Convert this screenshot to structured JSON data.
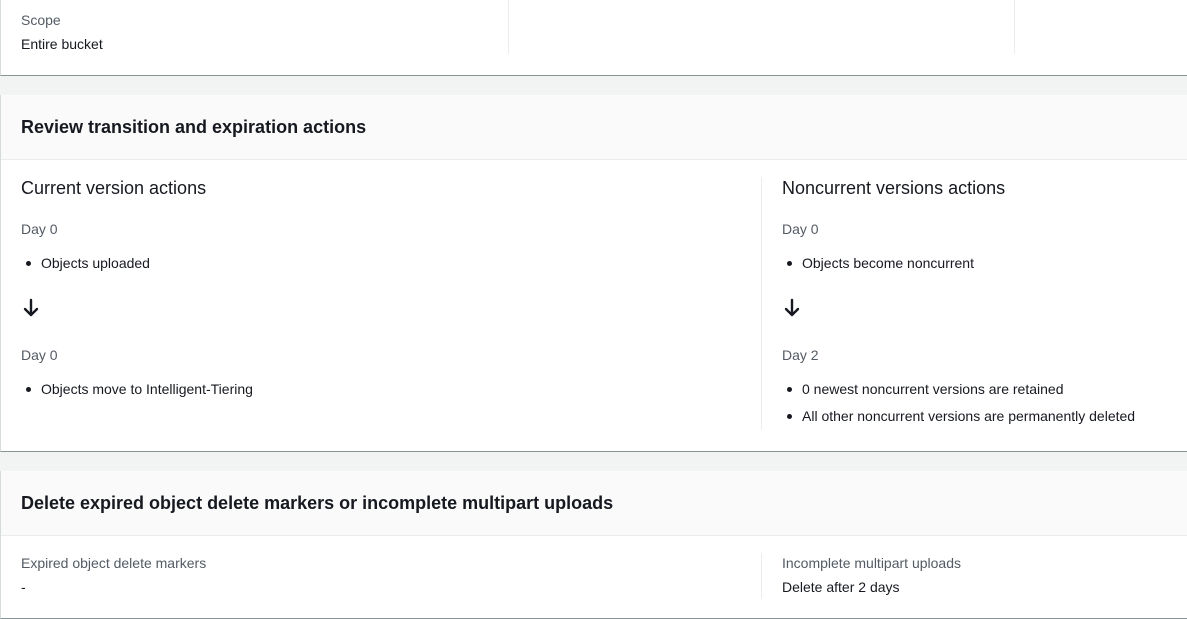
{
  "scope": {
    "label": "Scope",
    "value": "Entire bucket"
  },
  "review": {
    "title": "Review transition and expiration actions",
    "current": {
      "title": "Current version actions",
      "steps": [
        {
          "day": "Day 0",
          "items": [
            "Objects uploaded"
          ]
        },
        {
          "day": "Day 0",
          "items": [
            "Objects move to Intelligent-Tiering"
          ]
        }
      ]
    },
    "noncurrent": {
      "title": "Noncurrent versions actions",
      "steps": [
        {
          "day": "Day 0",
          "items": [
            "Objects become noncurrent"
          ]
        },
        {
          "day": "Day 2",
          "items": [
            "0 newest noncurrent versions are retained",
            "All other noncurrent versions are permanently deleted"
          ]
        }
      ]
    },
    "arrow_icon": "arrow-down-icon"
  },
  "delete": {
    "title": "Delete expired object delete markers or incomplete multipart uploads",
    "expired_markers": {
      "label": "Expired object delete markers",
      "value": "-"
    },
    "incomplete_uploads": {
      "label": "Incomplete multipart uploads",
      "value": "Delete after 2 days"
    }
  }
}
